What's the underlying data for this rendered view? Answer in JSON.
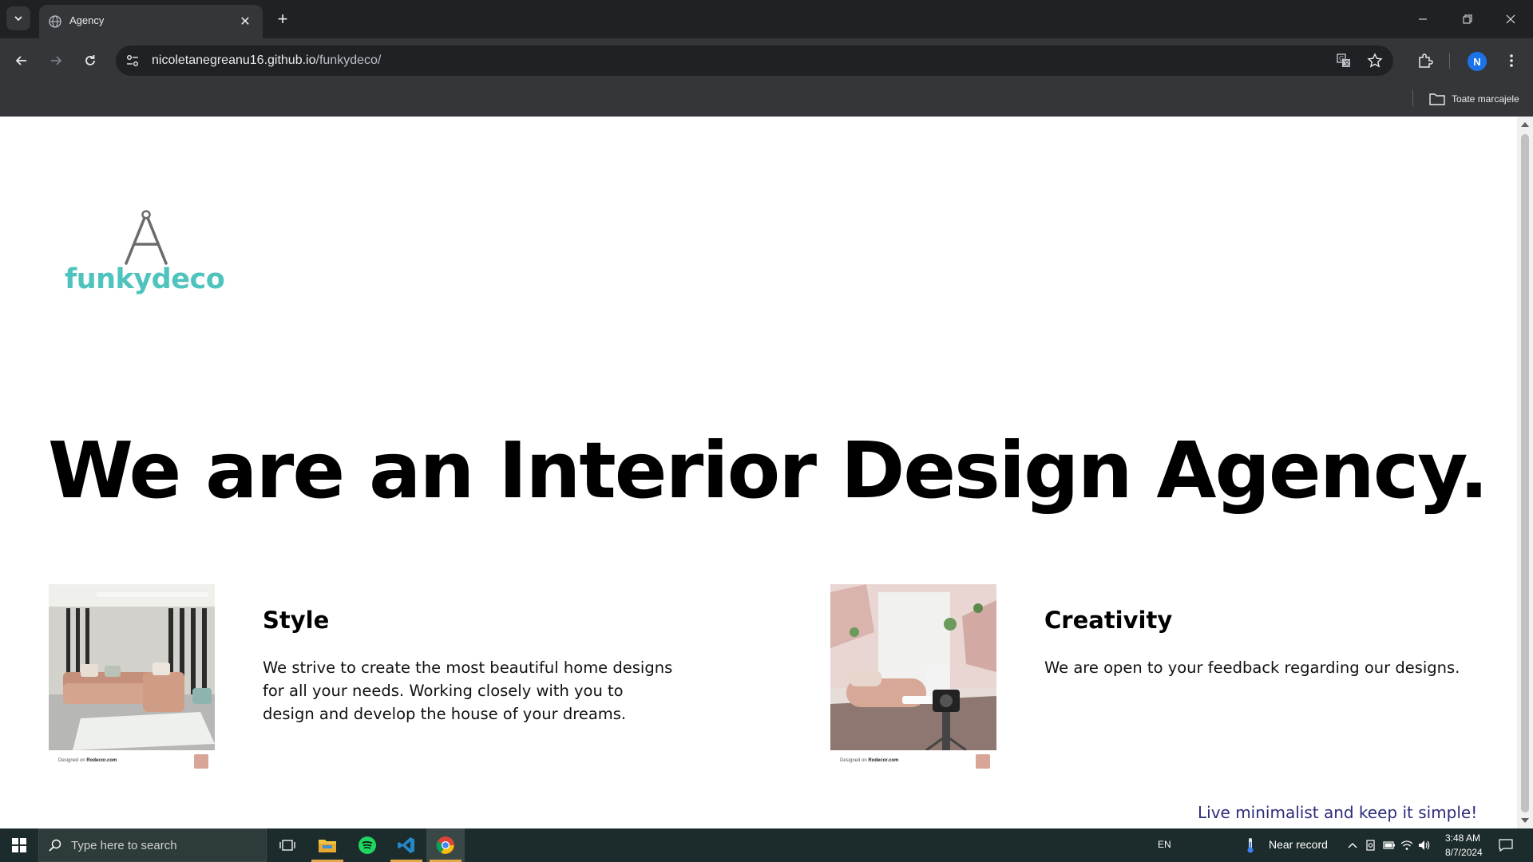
{
  "browser": {
    "tab_title": "Agency",
    "url_host": "nicoletanegreanu16.github.io",
    "url_path": "/funkydeco/",
    "bookmarks_label": "Toate marcajele",
    "profile_initial": "N"
  },
  "site": {
    "logo_text": "funkydeco",
    "hero_title": "We are an Interior Design Agency.",
    "cards": [
      {
        "title": "Style",
        "text": "We strive to create the most beautiful home designs for all your needs. Working closely with you to design and develop the house of your dreams.",
        "credit_prefix": "Designed on",
        "credit_brand": "Rodecor.com"
      },
      {
        "title": "Creativity",
        "text": "We are open to your feedback regarding our designs.",
        "credit_prefix": "Designed on",
        "credit_brand": "Rodecor.com"
      }
    ],
    "tagline": "Live minimalist and keep it simple!"
  },
  "taskbar": {
    "search_placeholder": "Type here to search",
    "language": "EN",
    "weather": "Near record",
    "time": "3:48 AM",
    "date": "8/7/2024"
  },
  "colors": {
    "logo": "#4fc3bd",
    "tagline": "#2c2c7a",
    "tab_strip": "#202124",
    "toolbar": "#35363a",
    "taskbar": "#1c2b2b"
  }
}
